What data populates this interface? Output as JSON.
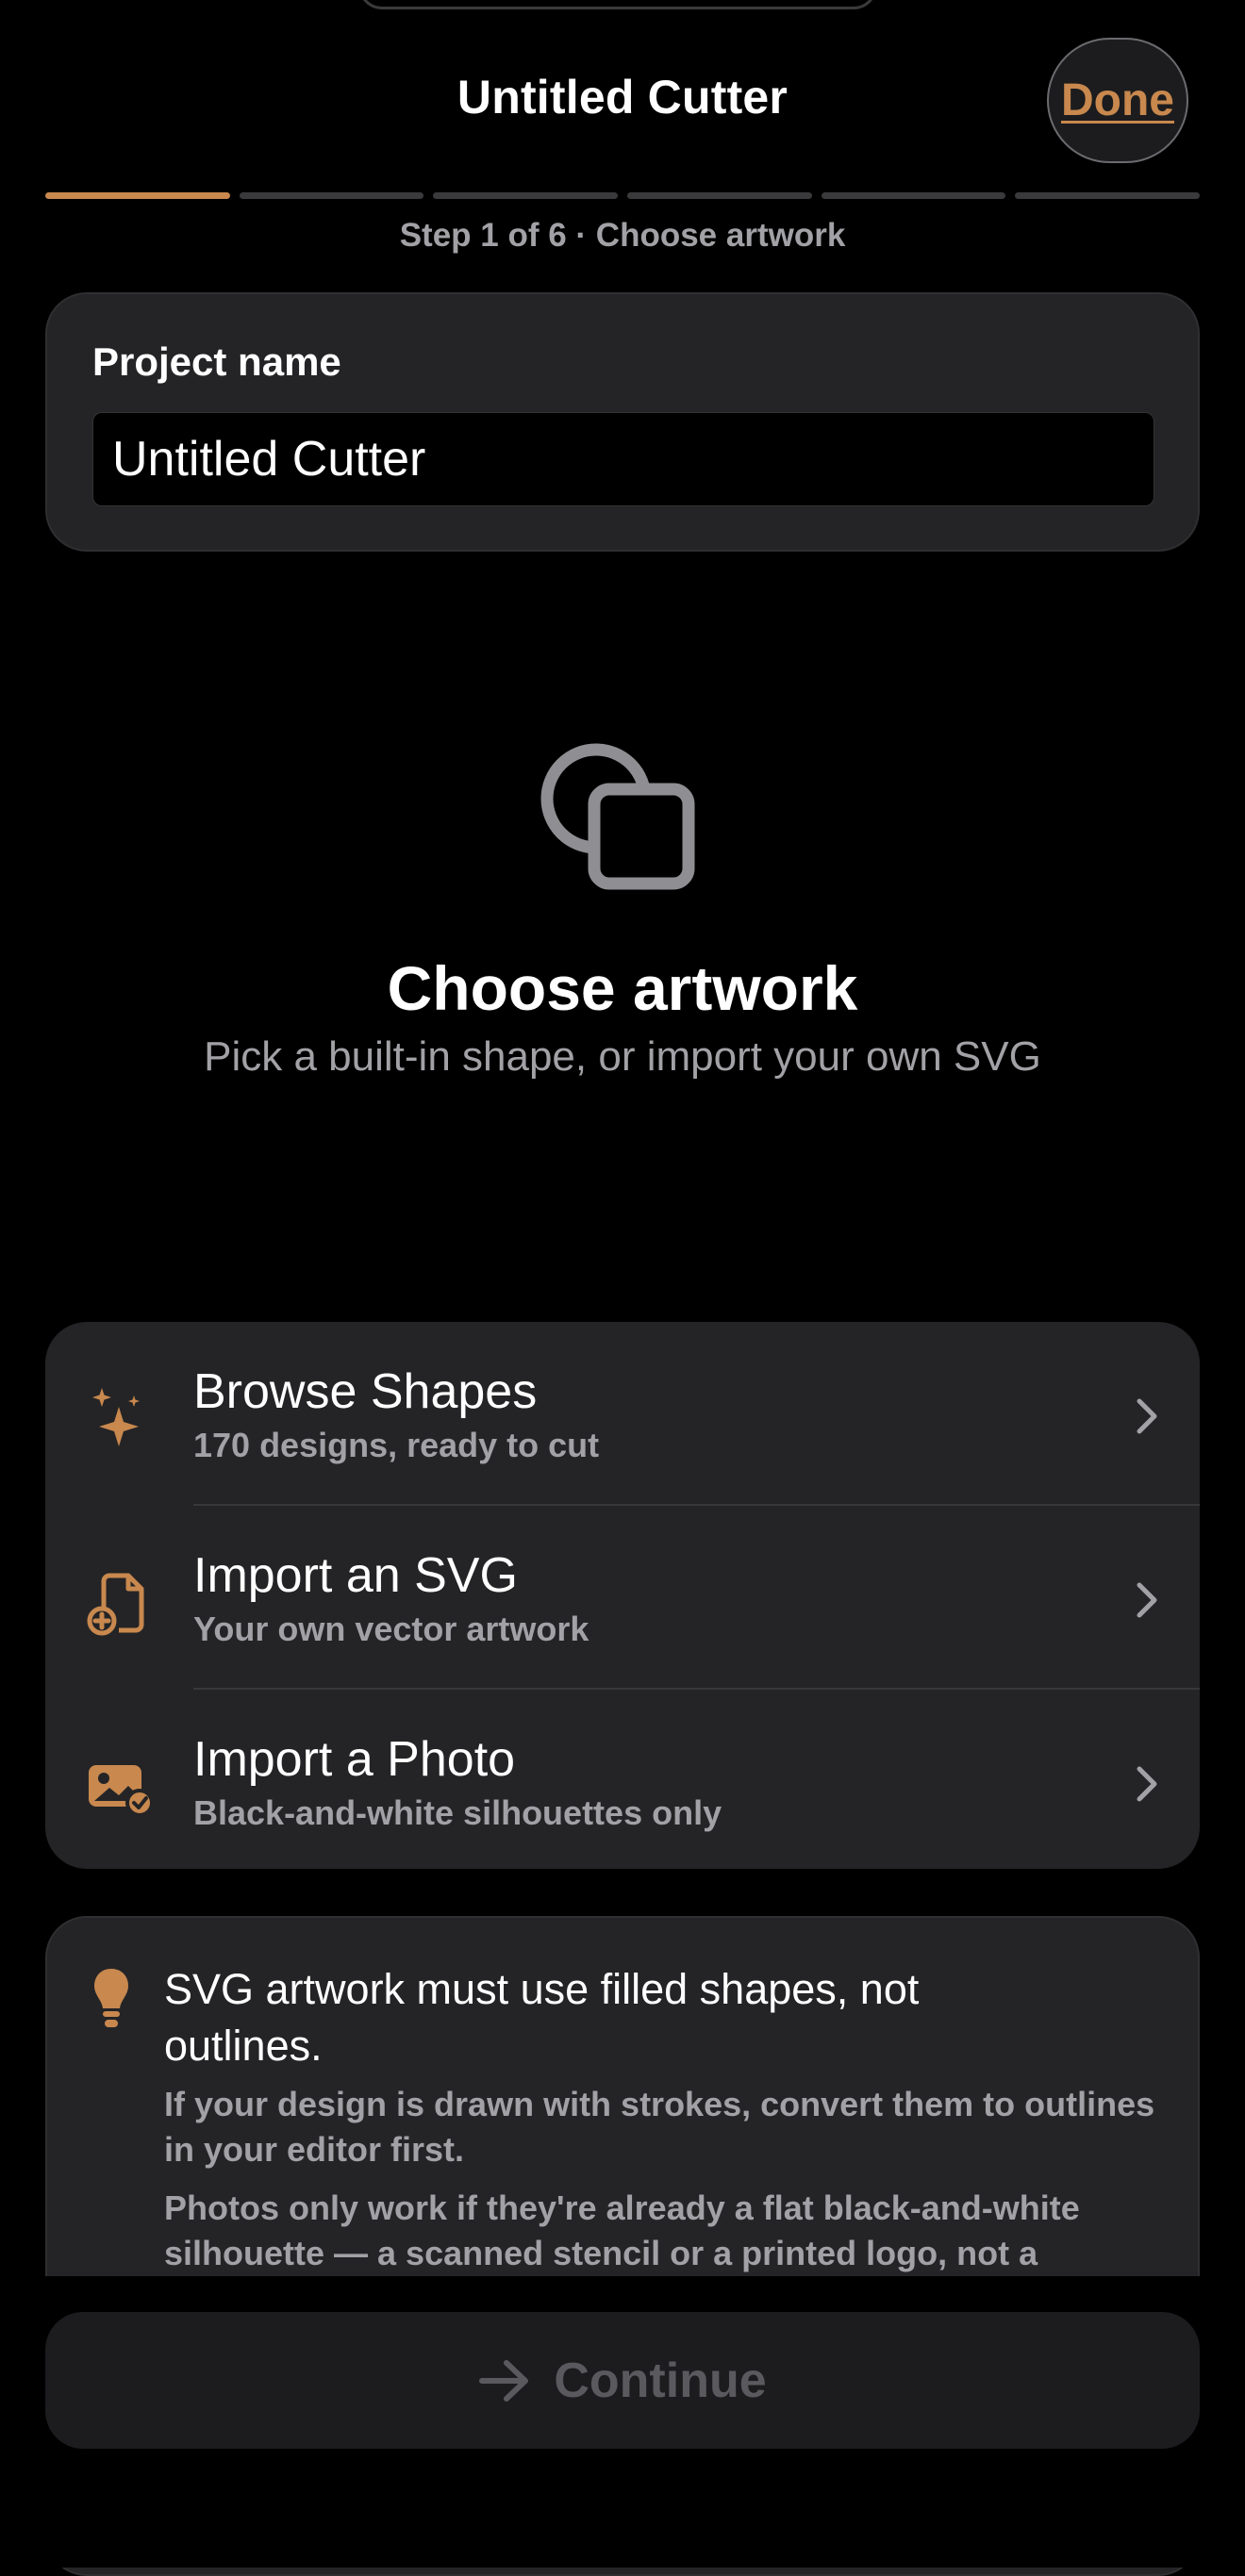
{
  "nav": {
    "title": "Untitled Cutter",
    "done_label": "Done"
  },
  "progress": {
    "total_steps": 6,
    "current_step": 1,
    "label": "Step 1 of 6 · Choose artwork"
  },
  "project": {
    "label": "Project name",
    "value": "Untitled Cutter"
  },
  "hero": {
    "icon": "shapes-icon",
    "title": "Choose artwork",
    "subtitle": "Pick a built-in shape, or import your own SVG"
  },
  "options": [
    {
      "icon": "sparkles-icon",
      "title": "Browse Shapes",
      "subtitle": "170 designs, ready to cut"
    },
    {
      "icon": "document-add-icon",
      "title": "Import an SVG",
      "subtitle": "Your own vector artwork"
    },
    {
      "icon": "photo-check-icon",
      "title": "Import a Photo",
      "subtitle": "Black-and-white silhouettes only"
    }
  ],
  "tip": {
    "icon": "lightbulb-icon",
    "title": "SVG artwork must use filled shapes, not outlines.",
    "paragraph1": "If your design is drawn with strokes, convert them to outlines in your editor first.",
    "paragraph2": "Photos only work if they're already a flat black-and-white silhouette — a scanned stencil or a printed logo, not a"
  },
  "footer": {
    "continue_label": "Continue",
    "continue_icon": "arrow-right-icon"
  },
  "colors": {
    "accent": "#c8884e",
    "background": "#000000",
    "card": "#242426",
    "secondary_text": "#a1a1a6"
  }
}
